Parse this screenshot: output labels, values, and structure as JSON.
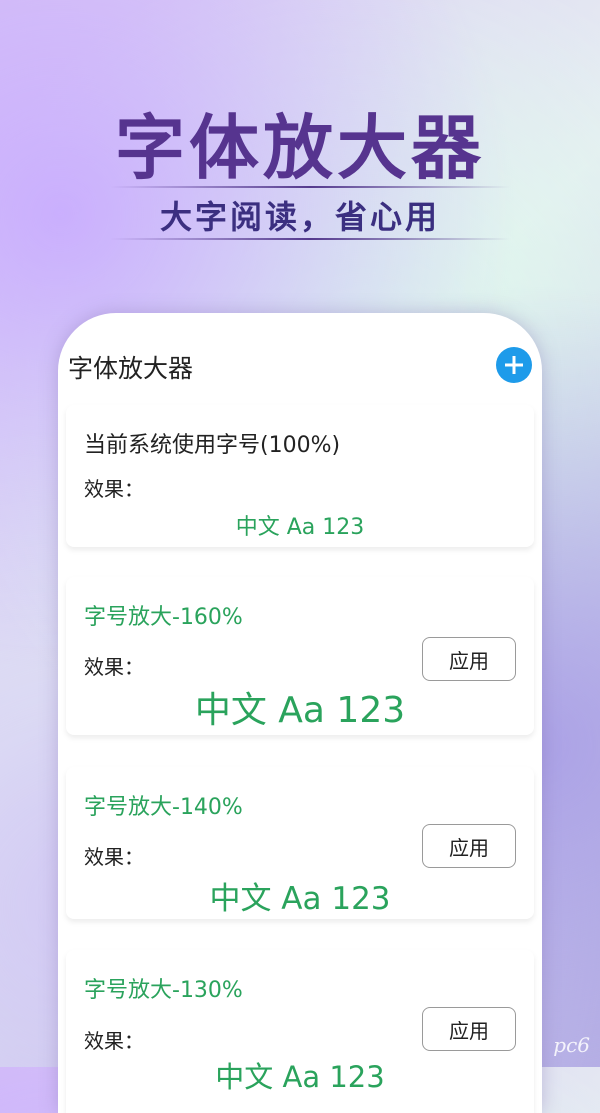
{
  "hero": {
    "title": "字体放大器",
    "subtitle": "大字阅读，省心用"
  },
  "app": {
    "title": "字体放大器",
    "add_icon": "plus-icon"
  },
  "colors": {
    "accent_green": "#2aa35c",
    "add_button_blue": "#1e9bea",
    "hero_purple": "#56348f"
  },
  "cards": [
    {
      "title": "当前系统使用字号(100%)",
      "effect_label": "效果：",
      "sample": "中文 Aa 123"
    },
    {
      "title": "字号放大-160%",
      "effect_label": "效果：",
      "sample": "中文 Aa 123",
      "button": "应用"
    },
    {
      "title": "字号放大-140%",
      "effect_label": "效果：",
      "sample": "中文 Aa 123",
      "button": "应用"
    },
    {
      "title": "字号放大-130%",
      "effect_label": "效果：",
      "sample": "中文 Aa 123",
      "button": "应用"
    }
  ],
  "watermark": "pc6"
}
